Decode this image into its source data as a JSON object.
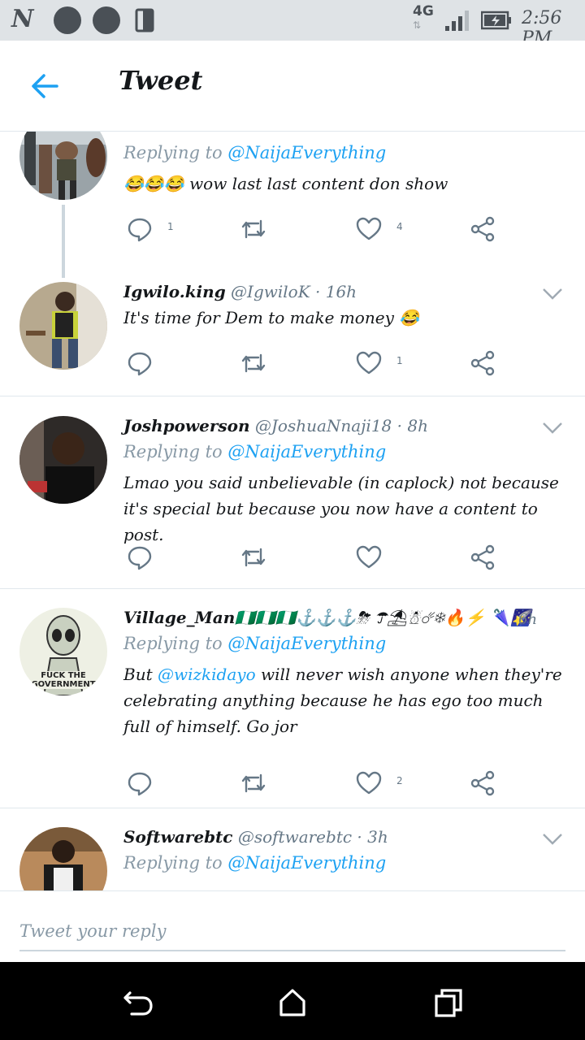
{
  "status_bar": {
    "network": "4G",
    "time": "2:56 PM",
    "icons": [
      "notification-n-icon",
      "circle-icon",
      "circle-icon",
      "phone-icon",
      "signal-icon",
      "battery-icon"
    ]
  },
  "header": {
    "title": "Tweet",
    "back_icon": "back-arrow-icon"
  },
  "tweets": [
    {
      "reply_to_label": "Replying to",
      "reply_to_handle": "@NaijaEverything",
      "text": "😂😂😂 wow last last content don show",
      "reply_count": "1",
      "like_count": "4"
    },
    {
      "name": "Igwilo.king",
      "handle": "@IgwiloK",
      "time": "· 16h",
      "text": "It's time for Dem to make money 😂",
      "reply_count": "",
      "like_count": "1"
    },
    {
      "name": "Joshpowerson",
      "handle": "@JoshuaNnaji18",
      "time": "· 8h",
      "reply_to_label": "Replying to",
      "reply_to_handle": "@NaijaEverything",
      "text": "Lmao you said unbelievable (in caplock) not because it's special but because you now have a content to post.",
      "reply_count": "",
      "like_count": ""
    },
    {
      "name": "Village_Man",
      "name_emoji": "🇳🇬🇳🇬🇳🇬⚓⚓⚓⛈ ☂⛱☃☄❄🔥⚡ 🌂🌠",
      "handle": "",
      "time": "6h",
      "reply_to_label": "Replying to",
      "reply_to_handle": "@NaijaEverything",
      "mention": "@wizkidayo",
      "text_before": "But ",
      "text_after": " will never wish anyone when they're celebrating anything because he has ego too much full of himself. Go jor",
      "reply_count": "",
      "like_count": "2",
      "avatar_text": "FUCK THE GOVERNMENT"
    },
    {
      "name": "Softwarebtc",
      "handle": "@softwarebtc",
      "time": "· 3h",
      "reply_to_label": "Replying to",
      "reply_to_handle": "@NaijaEverything"
    }
  ],
  "compose": {
    "placeholder": "Tweet your reply"
  },
  "nav_bar": {
    "icons": [
      "back-nav-icon",
      "home-nav-icon",
      "recents-nav-icon"
    ]
  },
  "colors": {
    "accent": "#1da1f2",
    "muted": "#657786",
    "divider": "#e1e8ed",
    "status_bar": "#dfe3e6",
    "nav_bar": "#000000"
  }
}
